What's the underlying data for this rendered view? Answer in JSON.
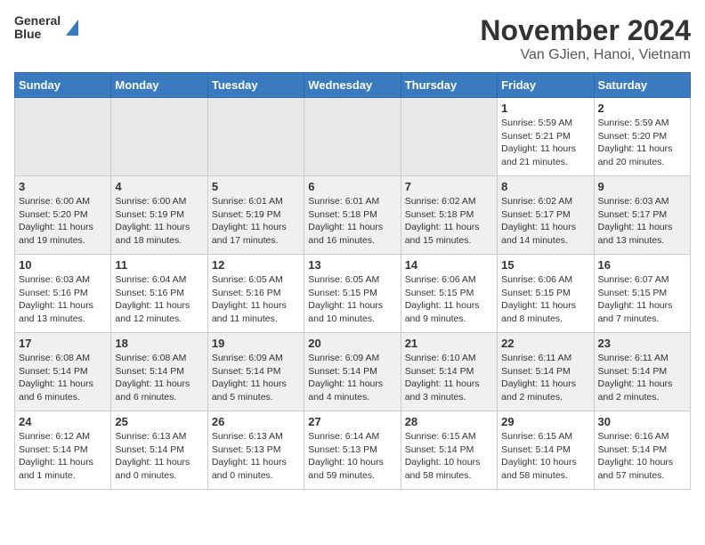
{
  "header": {
    "logo_line1": "General",
    "logo_line2": "Blue",
    "title": "November 2024",
    "subtitle": "Van GJien, Hanoi, Vietnam"
  },
  "calendar": {
    "days_of_week": [
      "Sunday",
      "Monday",
      "Tuesday",
      "Wednesday",
      "Thursday",
      "Friday",
      "Saturday"
    ],
    "weeks": [
      [
        {
          "day": "",
          "info": "",
          "empty": true
        },
        {
          "day": "",
          "info": "",
          "empty": true
        },
        {
          "day": "",
          "info": "",
          "empty": true
        },
        {
          "day": "",
          "info": "",
          "empty": true
        },
        {
          "day": "",
          "info": "",
          "empty": true
        },
        {
          "day": "1",
          "info": "Sunrise: 5:59 AM\nSunset: 5:21 PM\nDaylight: 11 hours\nand 21 minutes."
        },
        {
          "day": "2",
          "info": "Sunrise: 5:59 AM\nSunset: 5:20 PM\nDaylight: 11 hours\nand 20 minutes."
        }
      ],
      [
        {
          "day": "3",
          "info": "Sunrise: 6:00 AM\nSunset: 5:20 PM\nDaylight: 11 hours\nand 19 minutes."
        },
        {
          "day": "4",
          "info": "Sunrise: 6:00 AM\nSunset: 5:19 PM\nDaylight: 11 hours\nand 18 minutes."
        },
        {
          "day": "5",
          "info": "Sunrise: 6:01 AM\nSunset: 5:19 PM\nDaylight: 11 hours\nand 17 minutes."
        },
        {
          "day": "6",
          "info": "Sunrise: 6:01 AM\nSunset: 5:18 PM\nDaylight: 11 hours\nand 16 minutes."
        },
        {
          "day": "7",
          "info": "Sunrise: 6:02 AM\nSunset: 5:18 PM\nDaylight: 11 hours\nand 15 minutes."
        },
        {
          "day": "8",
          "info": "Sunrise: 6:02 AM\nSunset: 5:17 PM\nDaylight: 11 hours\nand 14 minutes."
        },
        {
          "day": "9",
          "info": "Sunrise: 6:03 AM\nSunset: 5:17 PM\nDaylight: 11 hours\nand 13 minutes."
        }
      ],
      [
        {
          "day": "10",
          "info": "Sunrise: 6:03 AM\nSunset: 5:16 PM\nDaylight: 11 hours\nand 13 minutes."
        },
        {
          "day": "11",
          "info": "Sunrise: 6:04 AM\nSunset: 5:16 PM\nDaylight: 11 hours\nand 12 minutes."
        },
        {
          "day": "12",
          "info": "Sunrise: 6:05 AM\nSunset: 5:16 PM\nDaylight: 11 hours\nand 11 minutes."
        },
        {
          "day": "13",
          "info": "Sunrise: 6:05 AM\nSunset: 5:15 PM\nDaylight: 11 hours\nand 10 minutes."
        },
        {
          "day": "14",
          "info": "Sunrise: 6:06 AM\nSunset: 5:15 PM\nDaylight: 11 hours\nand 9 minutes."
        },
        {
          "day": "15",
          "info": "Sunrise: 6:06 AM\nSunset: 5:15 PM\nDaylight: 11 hours\nand 8 minutes."
        },
        {
          "day": "16",
          "info": "Sunrise: 6:07 AM\nSunset: 5:15 PM\nDaylight: 11 hours\nand 7 minutes."
        }
      ],
      [
        {
          "day": "17",
          "info": "Sunrise: 6:08 AM\nSunset: 5:14 PM\nDaylight: 11 hours\nand 6 minutes."
        },
        {
          "day": "18",
          "info": "Sunrise: 6:08 AM\nSunset: 5:14 PM\nDaylight: 11 hours\nand 6 minutes."
        },
        {
          "day": "19",
          "info": "Sunrise: 6:09 AM\nSunset: 5:14 PM\nDaylight: 11 hours\nand 5 minutes."
        },
        {
          "day": "20",
          "info": "Sunrise: 6:09 AM\nSunset: 5:14 PM\nDaylight: 11 hours\nand 4 minutes."
        },
        {
          "day": "21",
          "info": "Sunrise: 6:10 AM\nSunset: 5:14 PM\nDaylight: 11 hours\nand 3 minutes."
        },
        {
          "day": "22",
          "info": "Sunrise: 6:11 AM\nSunset: 5:14 PM\nDaylight: 11 hours\nand 2 minutes."
        },
        {
          "day": "23",
          "info": "Sunrise: 6:11 AM\nSunset: 5:14 PM\nDaylight: 11 hours\nand 2 minutes."
        }
      ],
      [
        {
          "day": "24",
          "info": "Sunrise: 6:12 AM\nSunset: 5:14 PM\nDaylight: 11 hours\nand 1 minute."
        },
        {
          "day": "25",
          "info": "Sunrise: 6:13 AM\nSunset: 5:14 PM\nDaylight: 11 hours\nand 0 minutes."
        },
        {
          "day": "26",
          "info": "Sunrise: 6:13 AM\nSunset: 5:13 PM\nDaylight: 11 hours\nand 0 minutes."
        },
        {
          "day": "27",
          "info": "Sunrise: 6:14 AM\nSunset: 5:13 PM\nDaylight: 10 hours\nand 59 minutes."
        },
        {
          "day": "28",
          "info": "Sunrise: 6:15 AM\nSunset: 5:14 PM\nDaylight: 10 hours\nand 58 minutes."
        },
        {
          "day": "29",
          "info": "Sunrise: 6:15 AM\nSunset: 5:14 PM\nDaylight: 10 hours\nand 58 minutes."
        },
        {
          "day": "30",
          "info": "Sunrise: 6:16 AM\nSunset: 5:14 PM\nDaylight: 10 hours\nand 57 minutes."
        }
      ]
    ]
  }
}
